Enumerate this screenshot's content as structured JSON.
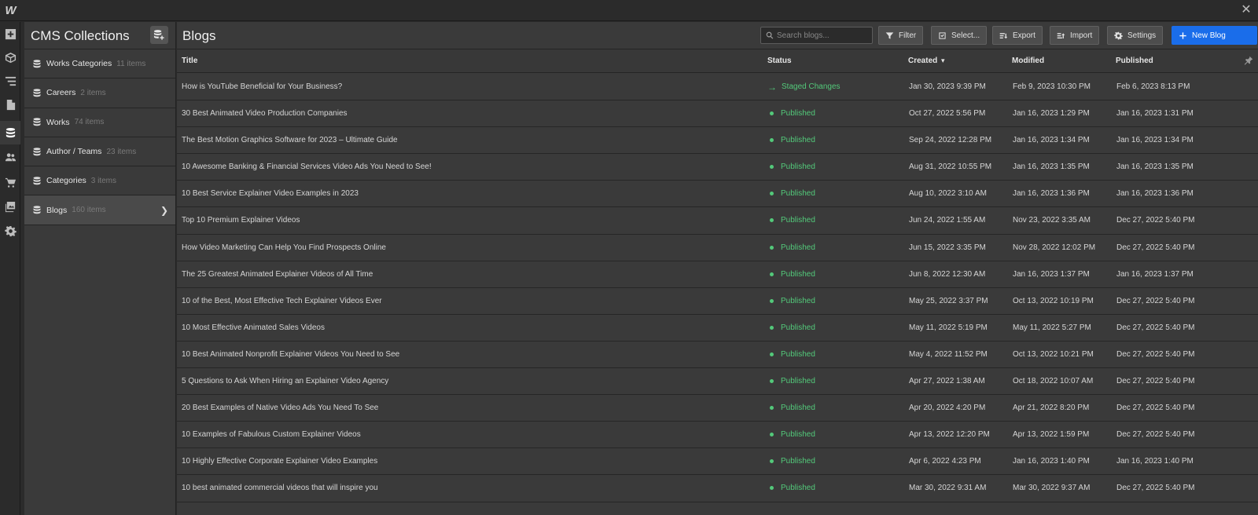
{
  "app": {
    "logo_text": "W",
    "close_glyph": "✕"
  },
  "rail": {
    "icons": [
      "add-icon",
      "box-icon",
      "navigator-icon",
      "pages-icon",
      "cms-icon",
      "users-icon",
      "ecommerce-icon",
      "assets-icon",
      "settings-icon"
    ],
    "active": "cms-icon"
  },
  "collections": {
    "title": "CMS Collections",
    "items": [
      {
        "name": "Works Categories",
        "count": "11 items"
      },
      {
        "name": "Careers",
        "count": "2 items"
      },
      {
        "name": "Works",
        "count": "74 items"
      },
      {
        "name": "Author / Teams",
        "count": "23 items"
      },
      {
        "name": "Categories",
        "count": "3 items"
      },
      {
        "name": "Blogs",
        "count": "160 items",
        "active": true
      }
    ]
  },
  "main": {
    "title": "Blogs",
    "search": {
      "placeholder": "Search blogs..."
    },
    "buttons": {
      "filter": "Filter",
      "select": "Select...",
      "export": "Export",
      "import": "Import",
      "settings": "Settings",
      "new": "New Blog"
    },
    "columns": {
      "title": "Title",
      "status": "Status",
      "created": "Created",
      "created_sort": "▾",
      "modified": "Modified",
      "published": "Published"
    },
    "colors": {
      "accent": "#1a6dea",
      "status_green": "#53c97a"
    },
    "rows": [
      {
        "title": "How is YouTube Beneficial for Your Business?",
        "status": "Staged Changes",
        "staged": true,
        "created": "Jan 30, 2023 9:39 PM",
        "modified": "Feb 9, 2023 10:30 PM",
        "published": "Feb 6, 2023 8:13 PM"
      },
      {
        "title": "30 Best Animated Video Production Companies",
        "status": "Published",
        "created": "Oct 27, 2022 5:56 PM",
        "modified": "Jan 16, 2023 1:29 PM",
        "published": "Jan 16, 2023 1:31 PM"
      },
      {
        "title": "The Best Motion Graphics Software for 2023 – Ultimate Guide",
        "status": "Published",
        "created": "Sep 24, 2022 12:28 PM",
        "modified": "Jan 16, 2023 1:34 PM",
        "published": "Jan 16, 2023 1:34 PM"
      },
      {
        "title": "10 Awesome Banking & Financial Services Video Ads You Need to See!",
        "status": "Published",
        "created": "Aug 31, 2022 10:55 PM",
        "modified": "Jan 16, 2023 1:35 PM",
        "published": "Jan 16, 2023 1:35 PM"
      },
      {
        "title": "10 Best Service Explainer Video Examples in 2023",
        "status": "Published",
        "created": "Aug 10, 2022 3:10 AM",
        "modified": "Jan 16, 2023 1:36 PM",
        "published": "Jan 16, 2023 1:36 PM"
      },
      {
        "title": "Top 10 Premium Explainer Videos",
        "status": "Published",
        "created": "Jun 24, 2022 1:55 AM",
        "modified": "Nov 23, 2022 3:35 AM",
        "published": "Dec 27, 2022 5:40 PM"
      },
      {
        "title": "How Video Marketing Can Help You Find Prospects Online",
        "status": "Published",
        "created": "Jun 15, 2022 3:35 PM",
        "modified": "Nov 28, 2022 12:02 PM",
        "published": "Dec 27, 2022 5:40 PM"
      },
      {
        "title": "The 25 Greatest Animated Explainer Videos of All Time",
        "status": "Published",
        "created": "Jun 8, 2022 12:30 AM",
        "modified": "Jan 16, 2023 1:37 PM",
        "published": "Jan 16, 2023 1:37 PM"
      },
      {
        "title": "10 of the Best, Most Effective Tech Explainer Videos Ever",
        "status": "Published",
        "created": "May 25, 2022 3:37 PM",
        "modified": "Oct 13, 2022 10:19 PM",
        "published": "Dec 27, 2022 5:40 PM"
      },
      {
        "title": "10 Most Effective Animated Sales Videos",
        "status": "Published",
        "created": "May 11, 2022 5:19 PM",
        "modified": "May 11, 2022 5:27 PM",
        "published": "Dec 27, 2022 5:40 PM"
      },
      {
        "title": "10 Best Animated Nonprofit Explainer Videos You Need to See",
        "status": "Published",
        "created": "May 4, 2022 11:52 PM",
        "modified": "Oct 13, 2022 10:21 PM",
        "published": "Dec 27, 2022 5:40 PM"
      },
      {
        "title": "5 Questions to Ask When Hiring an Explainer Video Agency",
        "status": "Published",
        "created": "Apr 27, 2022 1:38 AM",
        "modified": "Oct 18, 2022 10:07 AM",
        "published": "Dec 27, 2022 5:40 PM"
      },
      {
        "title": "20 Best Examples of Native Video Ads You Need To See",
        "status": "Published",
        "created": "Apr 20, 2022 4:20 PM",
        "modified": "Apr 21, 2022 8:20 PM",
        "published": "Dec 27, 2022 5:40 PM"
      },
      {
        "title": "10 Examples of Fabulous Custom Explainer Videos",
        "status": "Published",
        "created": "Apr 13, 2022 12:20 PM",
        "modified": "Apr 13, 2022 1:59 PM",
        "published": "Dec 27, 2022 5:40 PM"
      },
      {
        "title": "10 Highly Effective Corporate Explainer Video Examples",
        "status": "Published",
        "created": "Apr 6, 2022 4:23 PM",
        "modified": "Jan 16, 2023 1:40 PM",
        "published": "Jan 16, 2023 1:40 PM"
      },
      {
        "title": "10 best animated commercial videos that will inspire you",
        "status": "Published",
        "created": "Mar 30, 2022 9:31 AM",
        "modified": "Mar 30, 2022 9:37 AM",
        "published": "Dec 27, 2022 5:40 PM"
      }
    ]
  }
}
